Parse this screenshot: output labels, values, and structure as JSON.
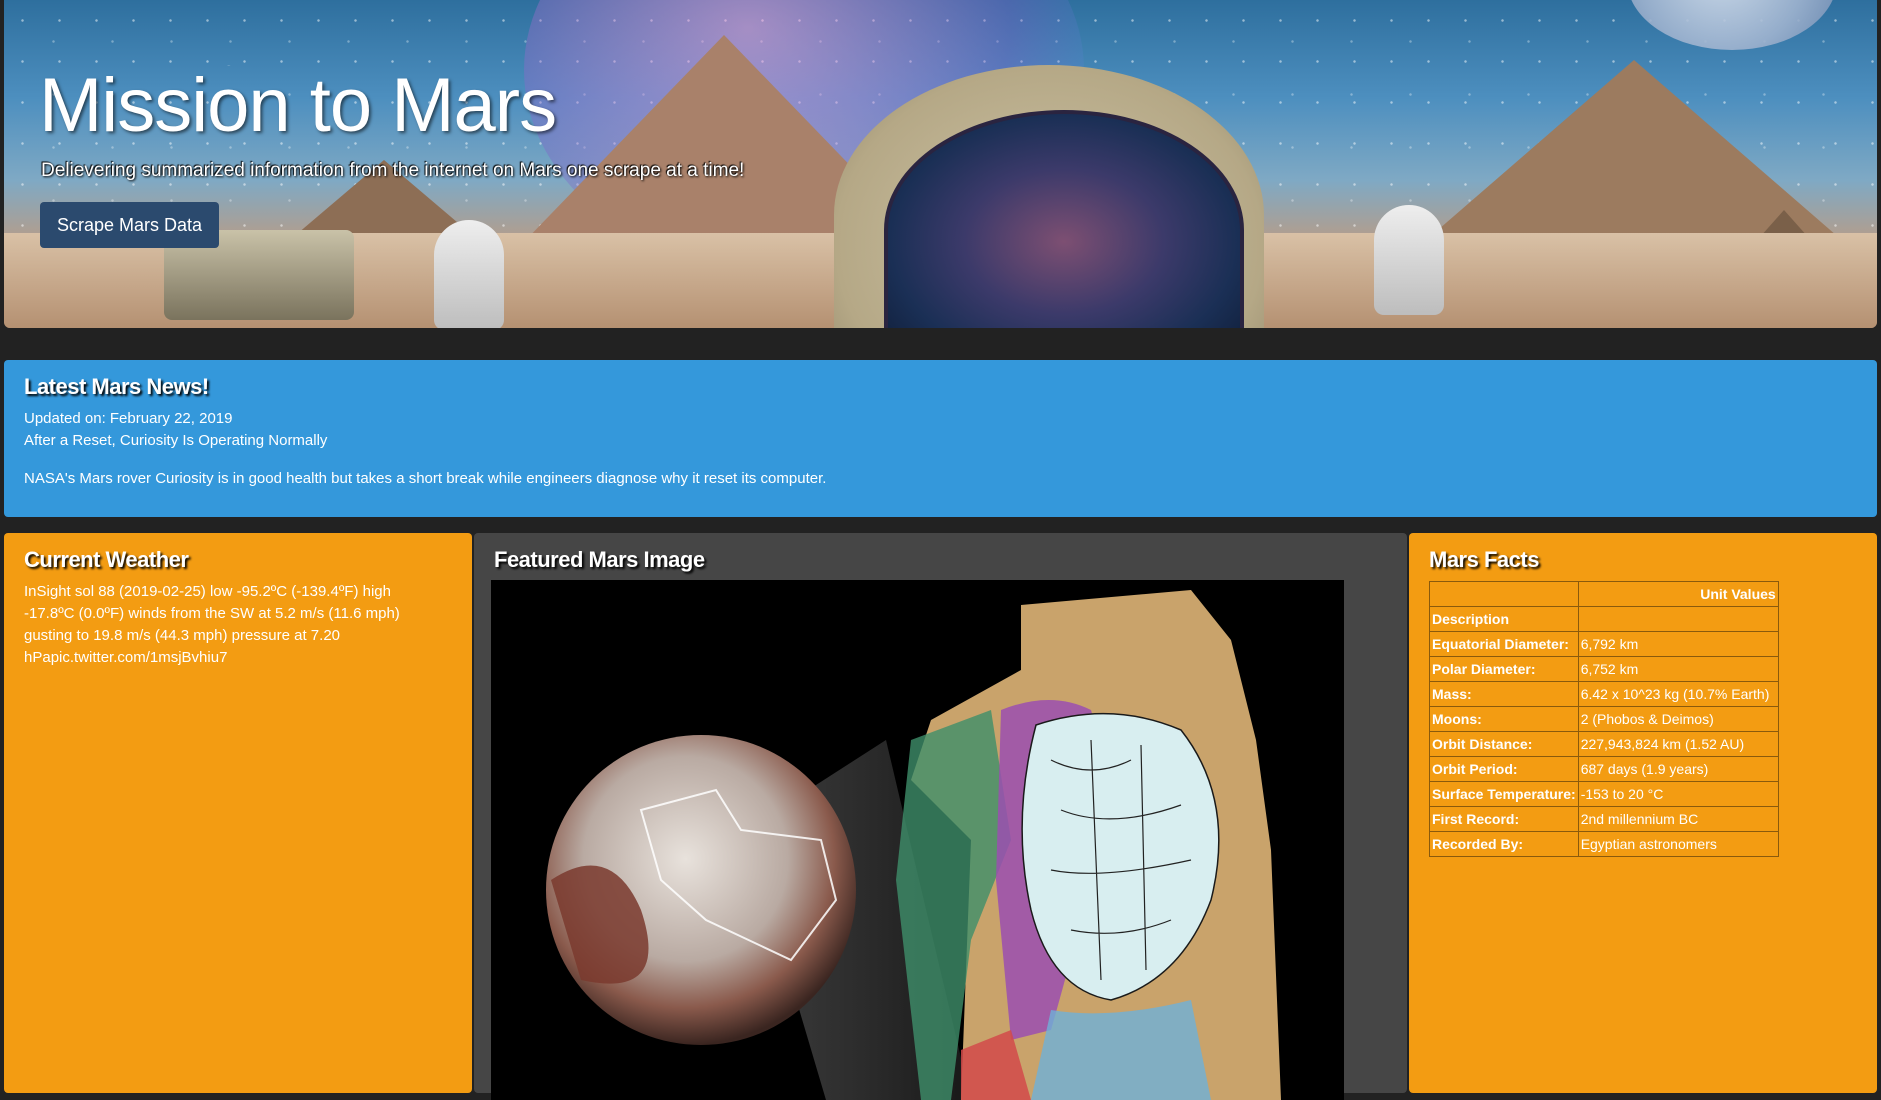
{
  "hero": {
    "title": "Mission to Mars",
    "subtitle": "Delievering summarized information from the internet on Mars one scrape at a time!",
    "button_label": "Scrape Mars Data"
  },
  "news": {
    "heading": "Latest Mars News!",
    "updated": "Updated on: February 22, 2019",
    "headline": "After a Reset, Curiosity Is Operating Normally",
    "teaser": "NASA's Mars rover Curiosity is in good health but takes a short break while engineers diagnose why it reset its computer."
  },
  "weather": {
    "heading": "Current Weather",
    "text": "InSight sol 88 (2019-02-25) low -95.2ºC (-139.4ºF) high -17.8ºC (0.0ºF) winds from the SW at 5.2 m/s (11.6 mph) gusting to 19.8 m/s (44.3 mph) pressure at 7.20 hPapic.twitter.com/1msjBvhiu7"
  },
  "featured": {
    "heading": "Featured Mars Image"
  },
  "facts": {
    "heading": "Mars Facts",
    "header_value": "Unit Values",
    "rows": [
      {
        "label": "Description",
        "value": ""
      },
      {
        "label": "Equatorial Diameter:",
        "value": "6,792 km"
      },
      {
        "label": "Polar Diameter:",
        "value": "6,752 km"
      },
      {
        "label": "Mass:",
        "value": "6.42 x 10^23 kg (10.7% Earth)"
      },
      {
        "label": "Moons:",
        "value": "2 (Phobos & Deimos)"
      },
      {
        "label": "Orbit Distance:",
        "value": "227,943,824 km (1.52 AU)"
      },
      {
        "label": "Orbit Period:",
        "value": "687 days (1.9 years)"
      },
      {
        "label": "Surface Temperature:",
        "value": "-153 to 20 °C"
      },
      {
        "label": "First Record:",
        "value": "2nd millennium BC"
      },
      {
        "label": "Recorded By:",
        "value": "Egyptian astronomers"
      }
    ]
  },
  "colors": {
    "page_bg": "#222222",
    "news_bg": "#3498db",
    "weather_bg": "#f39c12",
    "facts_bg": "#f39c12",
    "image_panel_bg": "#464646",
    "button_bg": "#2b4a6e"
  }
}
